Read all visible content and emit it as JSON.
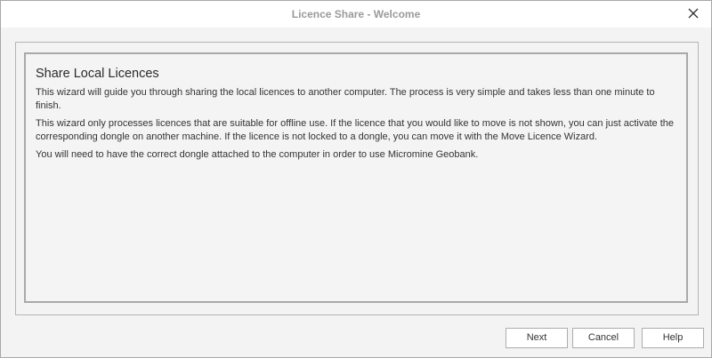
{
  "window": {
    "title": "Licence Share - Welcome"
  },
  "content": {
    "heading": "Share Local Licences",
    "paragraphs": [
      "This wizard will guide you through sharing the local licences to another computer. The process is very simple and takes less than one minute to finish.",
      "This wizard only processes licences that are suitable for offline use. If the licence that you would like to move is not shown, you can just activate the corresponding dongle on another machine. If the licence is not locked to a dongle, you can move it with the Move Licence Wizard.",
      "You will need to have the correct dongle attached to the computer in order to use Micromine Geobank."
    ]
  },
  "buttons": {
    "next": "Next",
    "cancel": "Cancel",
    "help": "Help"
  },
  "icons": {
    "close": "close-icon"
  }
}
